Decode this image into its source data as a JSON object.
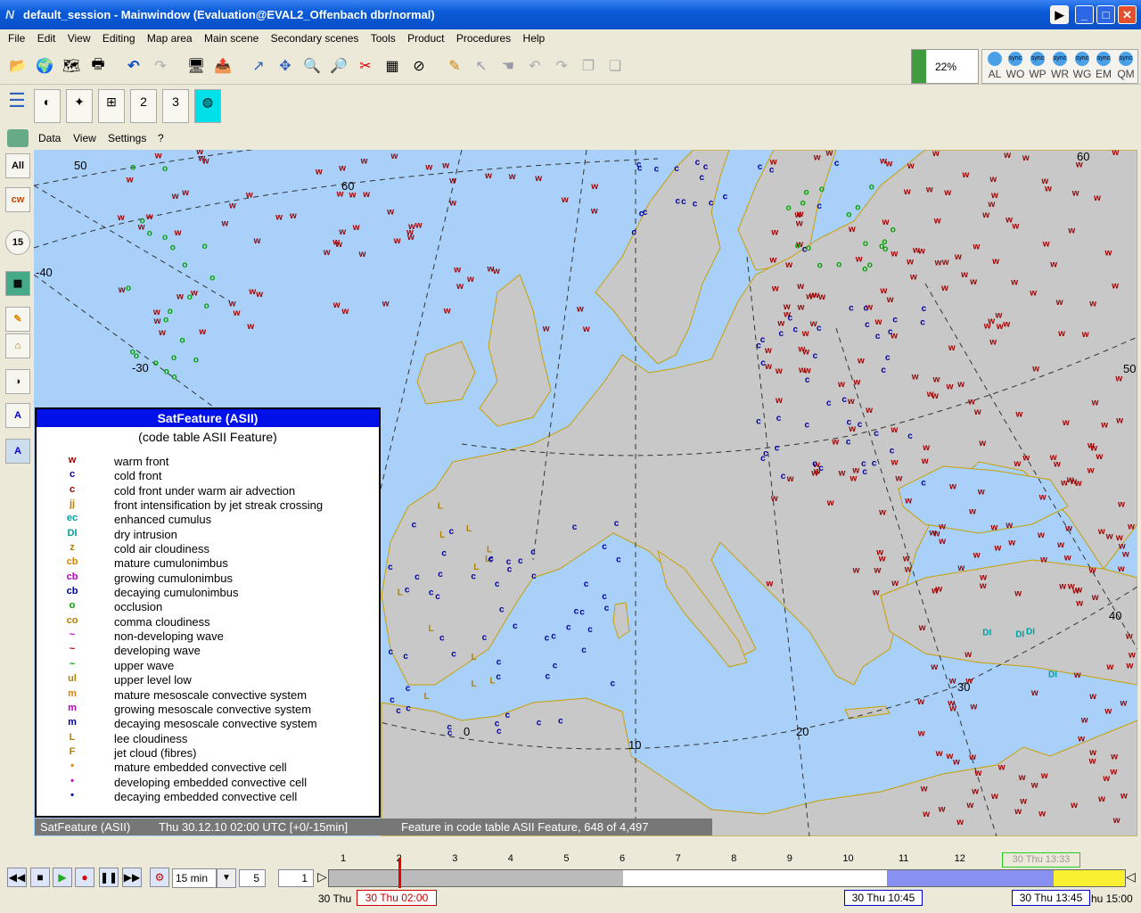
{
  "window": {
    "title": "default_session - Mainwindow (Evaluation@EVAL2_Offenbach dbr/normal)",
    "controls": [
      "▶",
      "_",
      "□",
      "✕"
    ]
  },
  "menu": [
    "File",
    "Edit",
    "View",
    "Editing",
    "Map area",
    "Main scene",
    "Secondary scenes",
    "Tools",
    "Product",
    "Procedures",
    "Help"
  ],
  "progress": {
    "label": "22%",
    "value": 0.22,
    "color": "#3f9d3f"
  },
  "sync": {
    "label": "sync",
    "items": [
      "AL",
      "WO",
      "WP",
      "WR",
      "WG",
      "EM",
      "QM"
    ]
  },
  "menu2": [
    "Data",
    "View",
    "Settings",
    "?"
  ],
  "sidebar": {
    "all_label": "All",
    "time_label": "15"
  },
  "map": {
    "lat_labels": [
      "50",
      "60",
      "60",
      "50",
      "40",
      "30"
    ],
    "lon_labels": [
      "-40",
      "-30",
      "0",
      "10",
      "20",
      "30",
      "40"
    ],
    "water_color": "#a8d0f8",
    "land_color": "#c8c8c8"
  },
  "legend": {
    "title": "SatFeature (ASII)",
    "subtitle": "(code table ASII Feature)",
    "items": [
      {
        "sym": "w",
        "color": "#a00000",
        "label": "warm front"
      },
      {
        "sym": "c",
        "color": "#0000a0",
        "label": "cold front"
      },
      {
        "sym": "c",
        "color": "#a00000",
        "label": "cold front under warm air advection"
      },
      {
        "sym": "jj",
        "color": "#b08000",
        "label": "front intensification by jet streak crossing"
      },
      {
        "sym": "ec",
        "color": "#00a0a0",
        "label": "enhanced cumulus"
      },
      {
        "sym": "DI",
        "color": "#00a0a0",
        "label": "dry intrusion"
      },
      {
        "sym": "z",
        "color": "#b08000",
        "label": "cold air cloudiness"
      },
      {
        "sym": "cb",
        "color": "#e08000",
        "label": "mature cumulonimbus"
      },
      {
        "sym": "cb",
        "color": "#c000c0",
        "label": "growing cumulonimbus"
      },
      {
        "sym": "cb",
        "color": "#0000a0",
        "label": "decaying cumulonimbus"
      },
      {
        "sym": "o",
        "color": "#00a000",
        "label": "occlusion"
      },
      {
        "sym": "co",
        "color": "#b08000",
        "label": "comma cloudiness"
      },
      {
        "sym": "~",
        "color": "#c000c0",
        "label": "non-developing wave"
      },
      {
        "sym": "~",
        "color": "#a00000",
        "label": "developing wave"
      },
      {
        "sym": "~",
        "color": "#00a000",
        "label": "upper wave"
      },
      {
        "sym": "ul",
        "color": "#b08000",
        "label": "upper level low"
      },
      {
        "sym": "m",
        "color": "#e08000",
        "label": "mature mesoscale convective system"
      },
      {
        "sym": "m",
        "color": "#c000c0",
        "label": "growing mesoscale convective system"
      },
      {
        "sym": "m",
        "color": "#0000a0",
        "label": "decaying mesoscale convective system"
      },
      {
        "sym": "L",
        "color": "#b08000",
        "label": "lee cloudiness"
      },
      {
        "sym": "F",
        "color": "#b08000",
        "label": "jet cloud (fibres)"
      },
      {
        "sym": "•",
        "color": "#e08000",
        "label": "mature embedded convective cell"
      },
      {
        "sym": "•",
        "color": "#c000c0",
        "label": "developing embedded convective cell"
      },
      {
        "sym": "•",
        "color": "#0000a0",
        "label": "decaying embedded convective cell"
      }
    ]
  },
  "status": {
    "layer": "SatFeature (ASII)",
    "time": "Thu 30.12.10 02:00 UTC [+0/-15min]",
    "info": "Feature in code table ASII Feature, 648 of 4,497"
  },
  "timeline": {
    "step_select": "15 min",
    "field_a": "5",
    "field_b": "1",
    "ticks": [
      "1",
      "2",
      "3",
      "4",
      "5",
      "6",
      "7",
      "8",
      "9",
      "10",
      "11",
      "12"
    ],
    "current": "30 Thu 02:00",
    "start": "30 Thu",
    "mark_a": "30 Thu 10:45",
    "mark_b": "30 Thu 13:45",
    "end": "hu 15:00",
    "top_mark": "30 Thu 13:33"
  }
}
